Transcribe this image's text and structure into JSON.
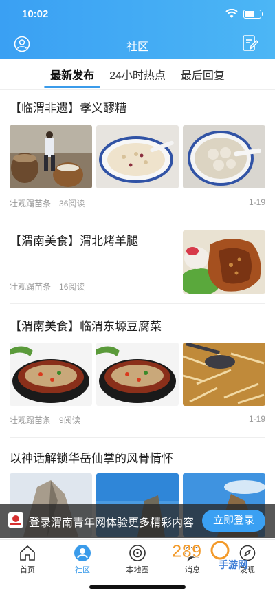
{
  "status": {
    "time": "10:02"
  },
  "nav": {
    "title": "社区"
  },
  "tabs": [
    {
      "label": "最新发布",
      "active": true
    },
    {
      "label": "24小时热点",
      "active": false
    },
    {
      "label": "最后回复",
      "active": false
    }
  ],
  "posts": [
    {
      "title": "【临渭非遗】孝义醪糟",
      "author": "壮观蹋苗条",
      "views": "36阅读",
      "date": "1-19"
    },
    {
      "title": "【渭南美食】渭北烤羊腿",
      "author": "壮观蹋苗条",
      "views": "16阅读",
      "date": ""
    },
    {
      "title": "【渭南美食】临渭东塬豆腐菜",
      "author": "壮观蹋苗条",
      "views": "9阅读",
      "date": "1-19"
    },
    {
      "title": "以神话解锁华岳仙掌的风骨情怀"
    }
  ],
  "banner": {
    "text": "登录渭南青年网体验更多精彩内容",
    "button": "立即登录"
  },
  "bottombar": [
    {
      "label": "首页",
      "icon": "home-icon",
      "active": false
    },
    {
      "label": "社区",
      "icon": "community-icon",
      "active": true
    },
    {
      "label": "本地圈",
      "icon": "local-circle-icon",
      "active": false
    },
    {
      "label": "消息",
      "icon": "message-icon",
      "active": false
    },
    {
      "label": "发现",
      "icon": "discover-icon",
      "active": false
    }
  ],
  "watermark": {
    "text": "289手游网"
  },
  "colors": {
    "accent": "#3a9bea",
    "header_start": "#3aa0f3",
    "header_end": "#4cb6f5"
  }
}
